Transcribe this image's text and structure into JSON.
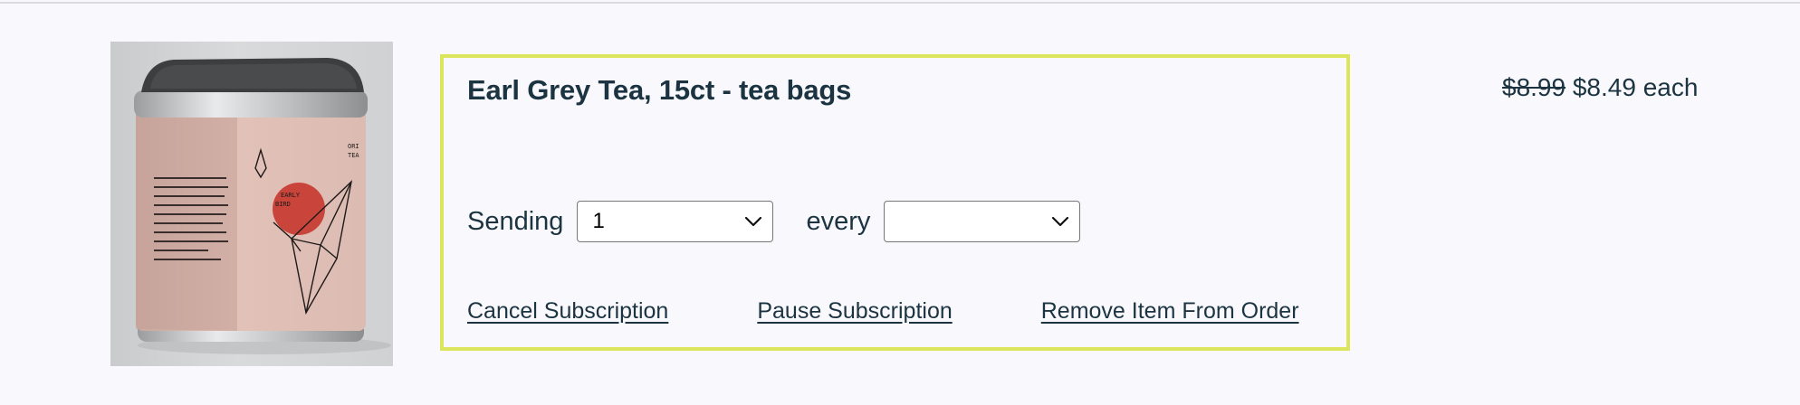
{
  "product": {
    "title": "Earl Grey Tea, 15ct - tea bags",
    "image_icon": "tea-tin-image",
    "tin_brand": [
      "ORI",
      "TEA"
    ],
    "tin_flavor": [
      "EARLY",
      "BIRD"
    ]
  },
  "subscription": {
    "sending_label": "Sending",
    "quantity_value": "1",
    "every_label": "every",
    "frequency_value": ""
  },
  "actions": {
    "cancel": "Cancel Subscription",
    "pause": "Pause Subscription",
    "remove": "Remove Item From Order"
  },
  "price": {
    "original": "$8.99",
    "current": "$8.49 each"
  },
  "colors": {
    "highlight_border": "#dbe65d",
    "text": "#1c3442",
    "background": "#f9f9fd"
  }
}
